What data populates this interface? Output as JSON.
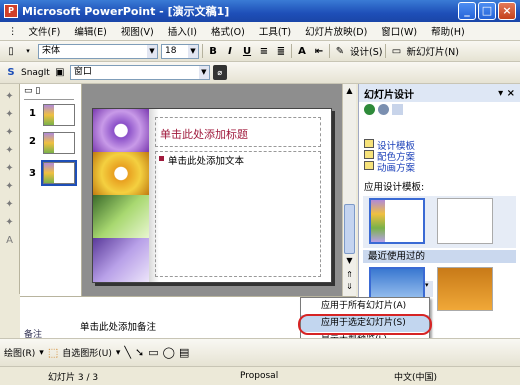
{
  "window": {
    "title": "Microsoft PowerPoint - [演示文稿1]",
    "min_label": "_",
    "max_label": "□",
    "close_label": "×"
  },
  "menu": [
    "文件(F)",
    "编辑(E)",
    "视图(V)",
    "插入(I)",
    "格式(O)",
    "工具(T)",
    "幻灯片放映(D)",
    "窗口(W)",
    "帮助(H)"
  ],
  "toolbar1": {
    "font": "宋体",
    "size": "18",
    "bold": "B",
    "italic": "I",
    "underline": "U",
    "grow": "A",
    "design_label": "设计(S)",
    "new_slide_label": "新幻灯片(N)"
  },
  "toolbar2": {
    "snagit_label": "SnagIt",
    "window_label": "窗口"
  },
  "slides_panel": {
    "numbers": [
      "1",
      "2",
      "3"
    ],
    "selected": "3"
  },
  "slide": {
    "title_placeholder": "单击此处添加标题",
    "text_placeholder": "单击此处添加文本"
  },
  "notes": {
    "placeholder": "单击此处添加备注",
    "label": "备注"
  },
  "task_pane": {
    "title": "幻灯片设计",
    "links": [
      "设计模板",
      "配色方案",
      "动画方案"
    ],
    "apply_label": "应用设计模板:",
    "recent_label": "最近使用过的"
  },
  "context_menu": {
    "items": [
      "应用于所有幻灯片(A)",
      "应用于选定幻灯片(S)",
      "显示大型预览(L)"
    ],
    "active_index": 1
  },
  "drawbar": {
    "draw_label": "绘图(R)",
    "autoshape_label": "自选图形(U)"
  },
  "status": {
    "slide_info": "幻灯片 3 / 3",
    "template": "Proposal",
    "language": "中文(中国)"
  },
  "colors": {
    "title_red": "#a01a3c",
    "accent": "#1e4fb8",
    "highlight_ring": "#d62424"
  }
}
